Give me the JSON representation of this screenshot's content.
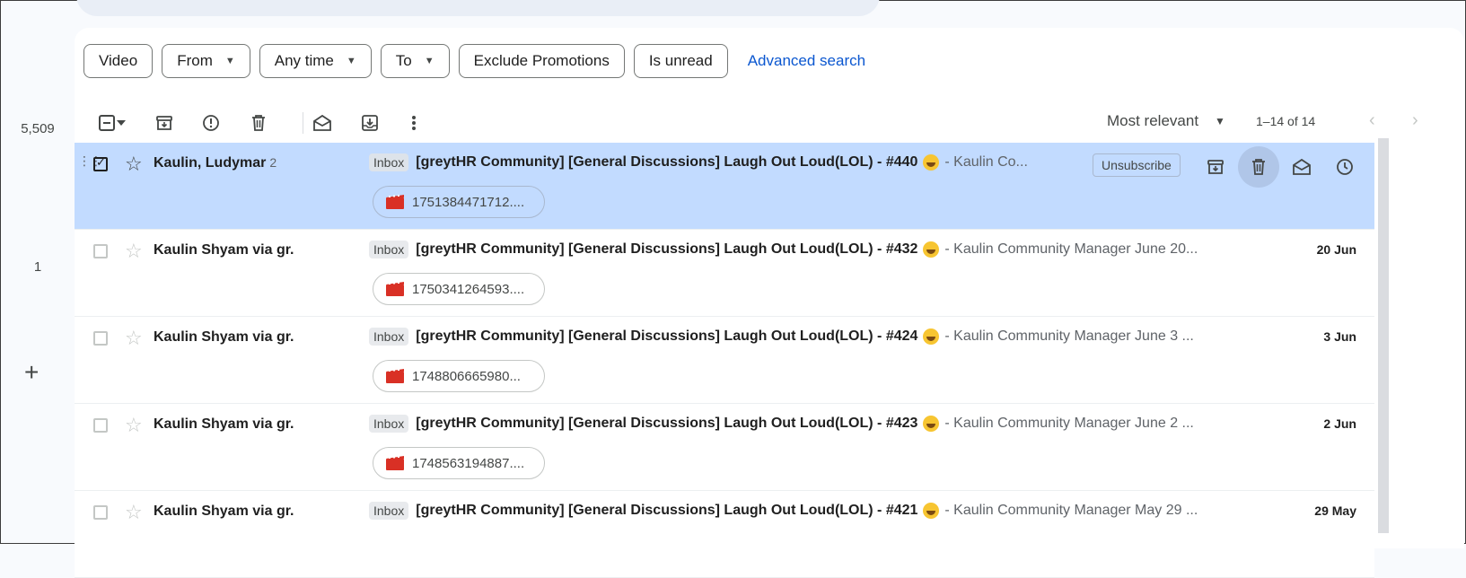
{
  "rail": {
    "counts": [
      "5,509",
      "1"
    ],
    "compose_symbol": "+"
  },
  "filters": {
    "chips": [
      {
        "label": "Video",
        "dropdown": false
      },
      {
        "label": "From",
        "dropdown": true
      },
      {
        "label": "Any time",
        "dropdown": true
      },
      {
        "label": "To",
        "dropdown": true
      },
      {
        "label": "Exclude Promotions",
        "dropdown": false
      },
      {
        "label": "Is unread",
        "dropdown": false
      }
    ],
    "advanced_search": "Advanced search"
  },
  "toolbar": {
    "sort_label": "Most relevant",
    "page_range": "1–14 of 14"
  },
  "emails": [
    {
      "sender": "Kaulin, Ludymar",
      "thread_count": "2",
      "label": "Inbox",
      "subject": "[greytHR Community] [General Discussions] Laugh Out Loud(LOL) - #440",
      "snippet": "- Kaulin Co...",
      "attachment": "1751384471712....",
      "date": "",
      "unsubscribe": "Unsubscribe",
      "selected": true
    },
    {
      "sender": "Kaulin Shyam via gr.",
      "thread_count": "",
      "label": "Inbox",
      "subject": "[greytHR Community] [General Discussions] Laugh Out Loud(LOL) - #432",
      "snippet": "- Kaulin Community Manager June 20...",
      "attachment": "1750341264593....",
      "date": "20 Jun",
      "selected": false
    },
    {
      "sender": "Kaulin Shyam via gr.",
      "thread_count": "",
      "label": "Inbox",
      "subject": "[greytHR Community] [General Discussions] Laugh Out Loud(LOL) - #424",
      "snippet": "- Kaulin Community Manager June 3 ...",
      "attachment": "1748806665980...",
      "date": "3 Jun",
      "selected": false
    },
    {
      "sender": "Kaulin Shyam via gr.",
      "thread_count": "",
      "label": "Inbox",
      "subject": "[greytHR Community] [General Discussions] Laugh Out Loud(LOL) - #423",
      "snippet": "- Kaulin Community Manager June 2 ...",
      "attachment": "1748563194887....",
      "date": "2 Jun",
      "selected": false
    },
    {
      "sender": "Kaulin Shyam via gr.",
      "thread_count": "",
      "label": "Inbox",
      "subject": "[greytHR Community] [General Discussions] Laugh Out Loud(LOL) - #421",
      "snippet": "- Kaulin Community Manager May 29 ...",
      "attachment": "",
      "date": "29 May",
      "selected": false
    }
  ],
  "colors": {
    "selected_row": "#c2dbff",
    "link": "#0b57d0",
    "attachment_icon": "#d93025"
  }
}
